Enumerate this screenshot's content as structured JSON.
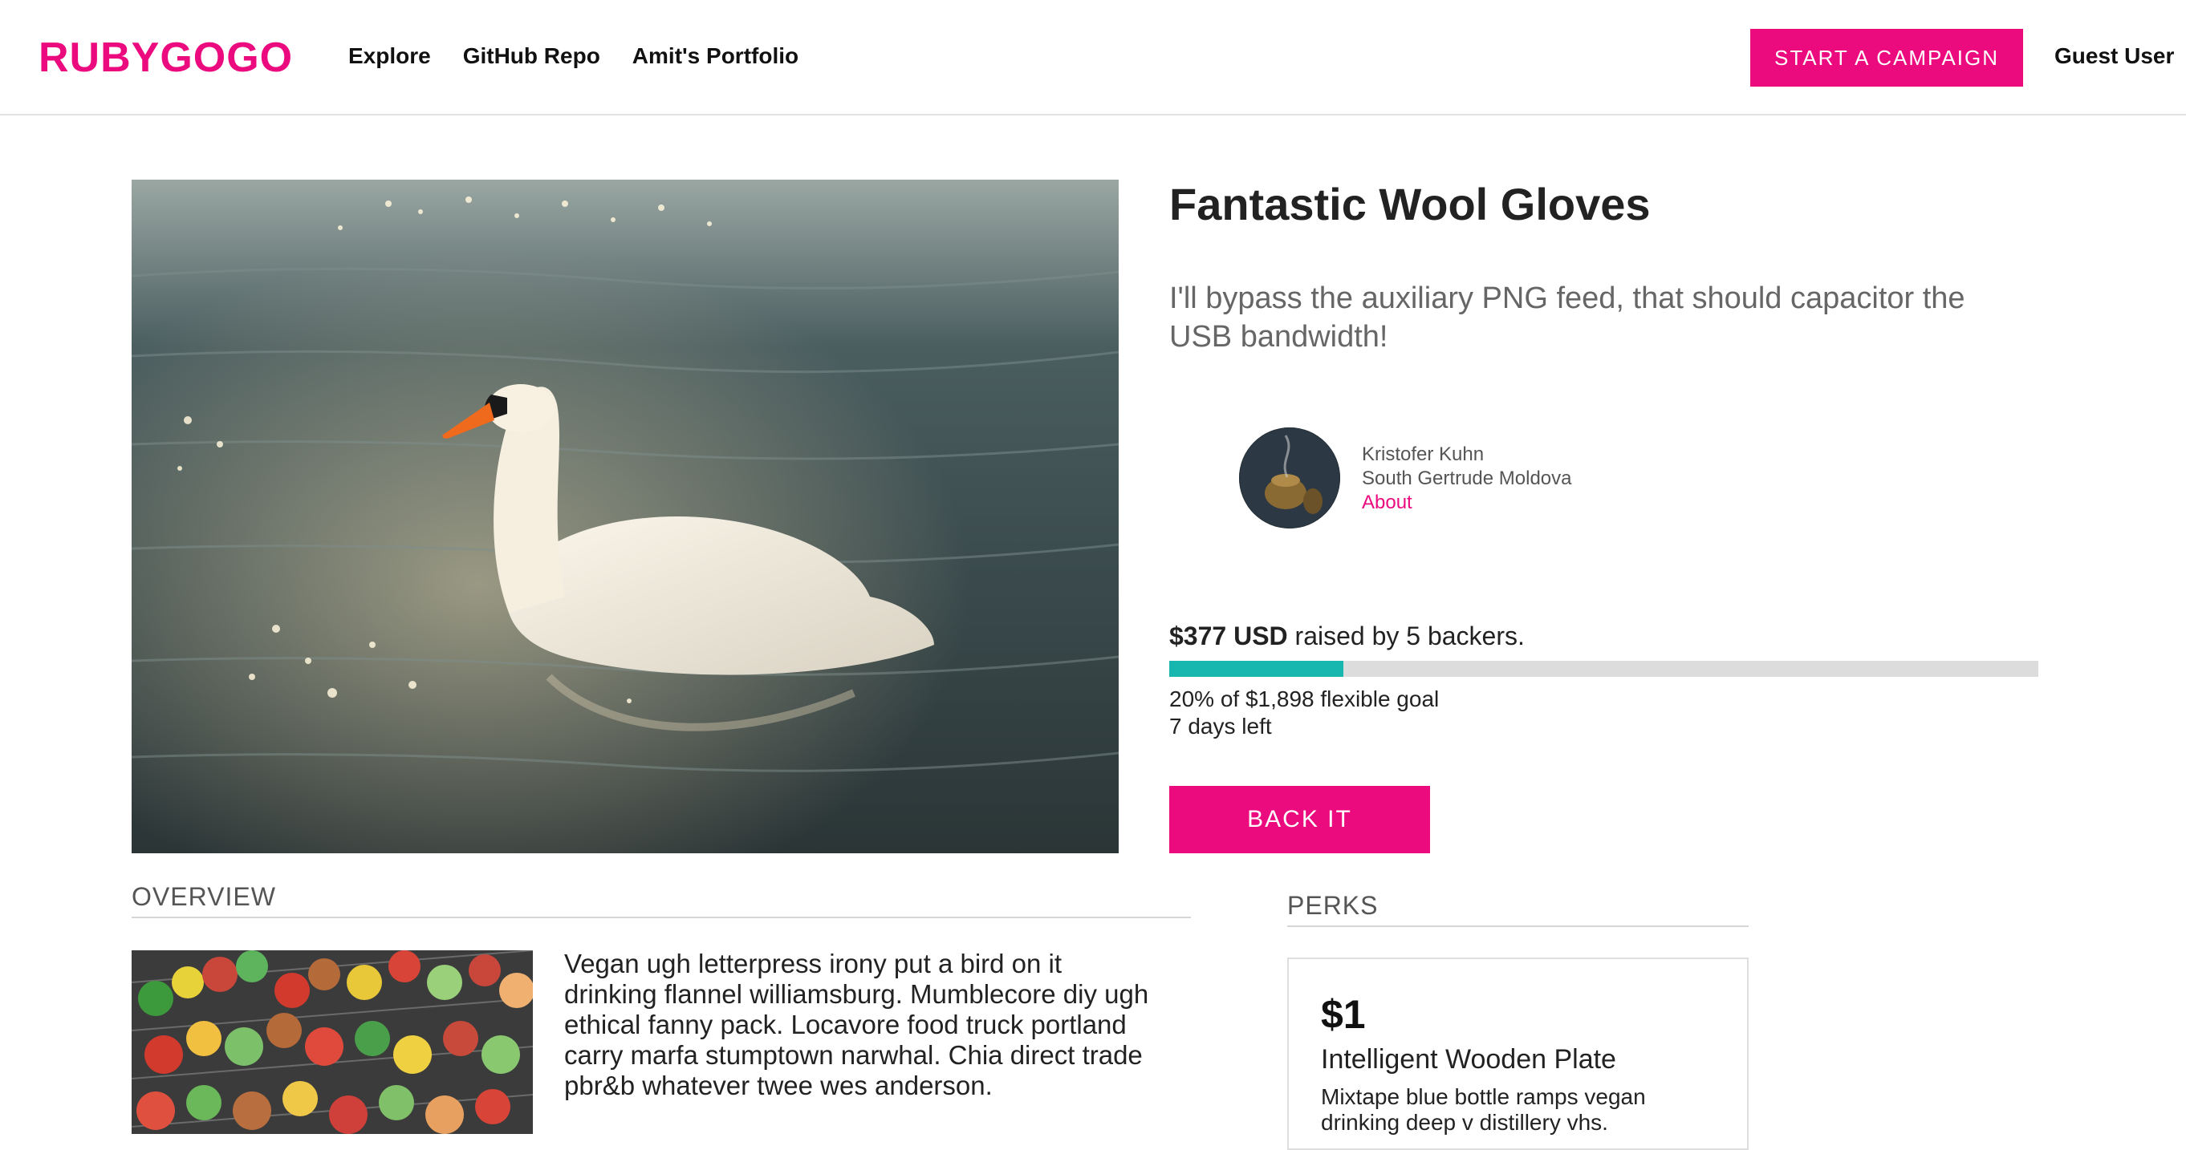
{
  "header": {
    "logo": "RUBYGOGO",
    "nav": [
      "Explore",
      "GitHub Repo",
      "Amit's Portfolio"
    ],
    "start_campaign": "START A CAMPAIGN",
    "user": "Guest User"
  },
  "campaign": {
    "title": "Fantastic Wool Gloves",
    "blurb": "I'll bypass the auxiliary PNG feed, that should capacitor the USB bandwidth!",
    "creator": {
      "name": "Kristofer Kuhn",
      "location": "South Gertrude Moldova",
      "about_link": "About"
    },
    "funding": {
      "amount": "$377 USD",
      "raised_text": "raised by 5 backers.",
      "progress_percent": 20,
      "goal_text": "20% of $1,898 flexible goal",
      "days_left": "7 days left"
    },
    "back_button": "BACK IT"
  },
  "overview": {
    "label": "OVERVIEW",
    "text": "Vegan ugh letterpress irony put a bird on it drinking flannel williamsburg. Mumblecore diy ugh ethical fanny pack. Locavore food truck portland carry marfa stumptown narwhal. Chia direct trade pbr&b whatever twee wes anderson."
  },
  "perks": {
    "label": "PERKS",
    "items": [
      {
        "price": "$1",
        "name": "Intelligent Wooden Plate",
        "description": "Mixtape blue bottle ramps vegan drinking deep v distillery vhs."
      }
    ]
  },
  "colors": {
    "brand": "#ec0a7f",
    "progress": "#17b7b0",
    "progress_track": "#dcdcdc"
  }
}
